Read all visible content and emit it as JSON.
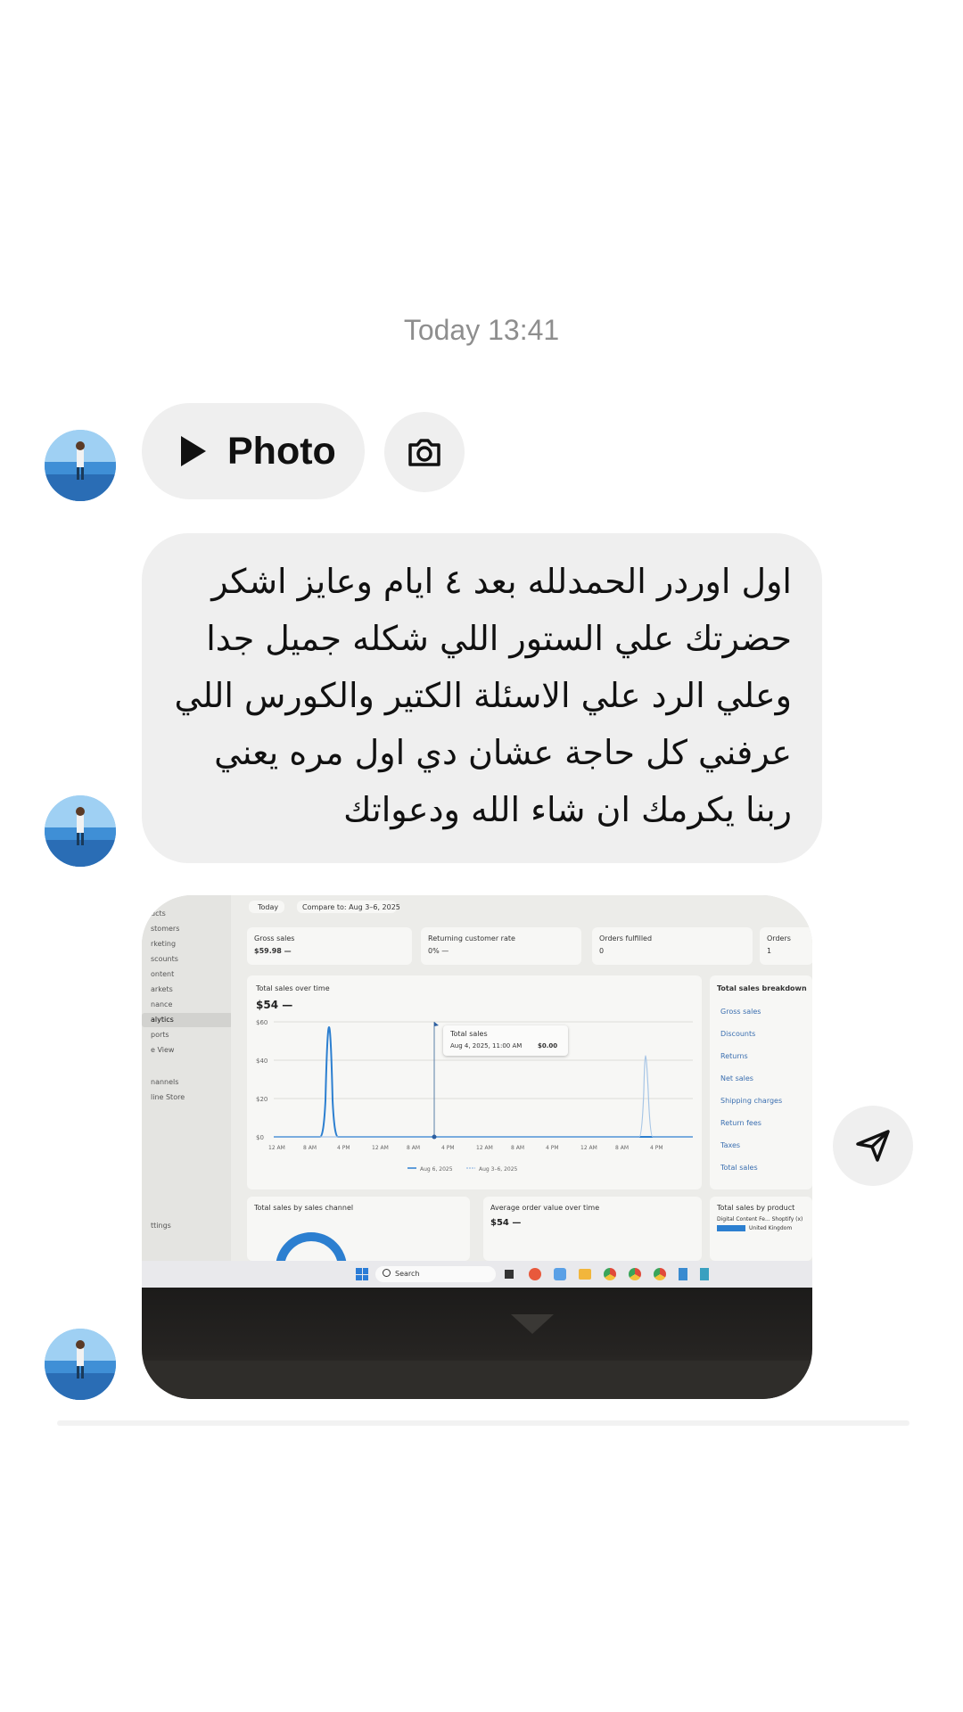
{
  "timestamp": "Today 13:41",
  "messages": {
    "photo_reply": {
      "label": "Photo"
    },
    "text_lines": [
      "اول اوردر الحمدلله بعد ٤ ايام وعايز اشكر",
      "حضرتك علي الستور اللي شكله جميل جدا",
      "وعلي الرد علي الاسئلة الكتير والكورس اللي",
      "عرفني كل حاجة عشان دي اول مره يعني",
      "ربنا يكرمك ان شاء الله ودعواتك"
    ]
  },
  "screenshot": {
    "today_btn": "Today",
    "compare_btn": "Compare to: Aug 3–6, 2025",
    "sidebar": [
      "ucts",
      "stomers",
      "rketing",
      "scounts",
      "ontent",
      "arkets",
      "nance",
      "alytics",
      "ports",
      "e View",
      "nannels",
      "line Store"
    ],
    "settings": "ttings",
    "metrics": [
      {
        "label": "Gross sales",
        "value": "$59.98 —"
      },
      {
        "label": "Returning customer rate",
        "value": "0% —"
      },
      {
        "label": "Orders fulfilled",
        "value": "0"
      },
      {
        "label": "Orders",
        "value": "1"
      }
    ],
    "chart_title": "Total sales over time",
    "chart_value": "$54 —",
    "y_ticks": [
      "$60",
      "$40",
      "$20",
      "$0"
    ],
    "x_ticks": [
      "12 AM",
      "8 AM",
      "4 PM",
      "12 AM",
      "8 AM",
      "4 PM",
      "12 AM",
      "8 AM",
      "4 PM",
      "12 AM",
      "8 AM",
      "4 PM"
    ],
    "tooltip_title": "Total sales",
    "tooltip_date": "Aug 4, 2025, 11:00 AM",
    "tooltip_value": "$0.00",
    "legend": [
      "Aug 6, 2025",
      "Aug 3–6, 2025"
    ],
    "breakdown_title": "Total sales breakdown",
    "breakdown_items": [
      "Gross sales",
      "Discounts",
      "Returns",
      "Net sales",
      "Shipping charges",
      "Return fees",
      "Taxes",
      "Total sales"
    ],
    "bottom_cards": [
      {
        "title": "Total sales by sales channel",
        "value": ""
      },
      {
        "title": "Average order value over time",
        "value": "$54 —"
      },
      {
        "title": "Total sales by product",
        "value": "Digital Content Fe... Shoptify (x)"
      }
    ],
    "bottom_detail": "United Kingdom",
    "search_placeholder": "Search"
  },
  "colors": {
    "bubble": "#efefef",
    "timestamp": "#8e8e8e",
    "chart_line": "#2c7fd0"
  },
  "icons": {
    "play": "play-icon",
    "camera": "camera-icon",
    "share": "send-icon"
  }
}
